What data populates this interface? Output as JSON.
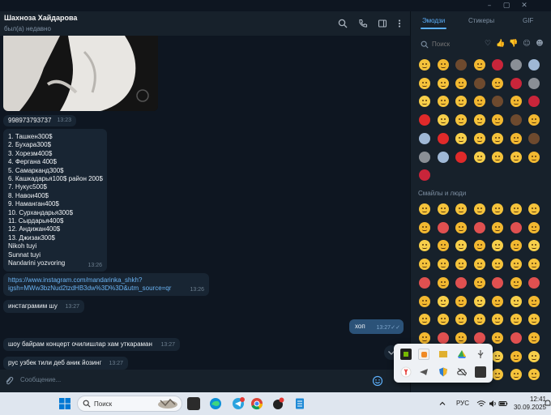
{
  "chat": {
    "peer_name": "Шахноза Хайдарова",
    "peer_status": "был(а) недавно",
    "messages": [
      {
        "text": "998973793737",
        "time": "13:23"
      },
      {
        "lines": [
          "1. Ташкен300$",
          "2. Бухара300$",
          "3. Хорезм400$",
          "4. Фергана 400$",
          "5. Самарканд300$",
          "6. Кашкадарья100$ район 200$",
          "7. Нукус500$",
          "8. Навои400$",
          "9. Наманган400$",
          "10. Сурхандарья300$",
          "11. Сырдарья400$",
          "12. Андижан400$",
          "13. Джизак300$",
          "Nikoh tuyi",
          "Sunnat tuyi",
          "Narxlarini yozvoring"
        ],
        "time": "13:26"
      },
      {
        "lines": [
          "https://www.instagram.com/mandarinka_shkh?",
          "igsh=MWw3bzNud2tzdHB3dw%3D%3D&utm_source=qr"
        ],
        "time": "13:26"
      },
      {
        "text": "инстаграмим шу",
        "time": "13:27"
      },
      {
        "text": "хоп",
        "time": "13:27"
      },
      {
        "text": "шоу байрам концерт очилишлар  хам уткараман",
        "time": "13:27"
      },
      {
        "text": "рус узбек тили деб аник йозинг",
        "time": "13:27"
      }
    ],
    "composer_placeholder": "Сообщение..."
  },
  "emoji_panel": {
    "tabs": [
      {
        "label": "Эмодзи",
        "active": true
      },
      {
        "label": "Стикеры",
        "active": false
      },
      {
        "label": "GIF",
        "active": false
      }
    ],
    "search_placeholder": "Поиск",
    "section_label": "Смайлы и люди"
  },
  "taskbar": {
    "search_placeholder": "Поиск",
    "language": "РУС",
    "time": "12:41",
    "date": "30.09.2025"
  },
  "colors": {
    "accent": "#5caffa",
    "bubble_in": "#182533",
    "bubble_out": "#2b5278",
    "bg": "#0e1621",
    "panel": "#17212b"
  }
}
